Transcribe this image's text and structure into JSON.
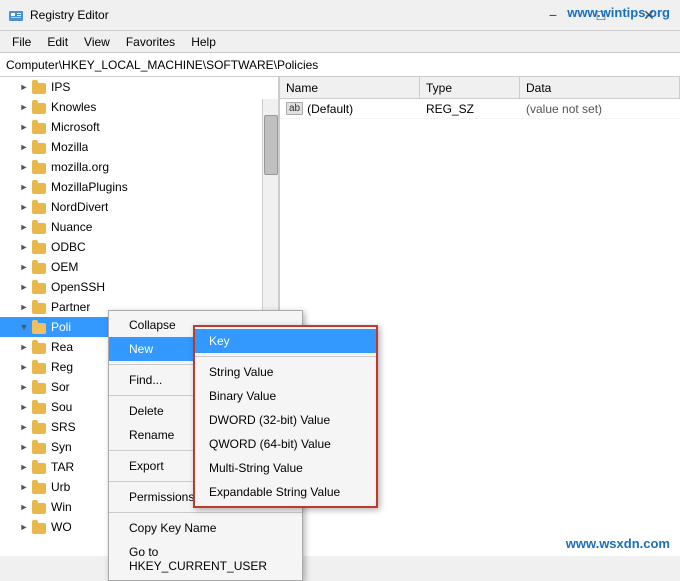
{
  "titleBar": {
    "title": "Registry Editor",
    "icon": "registry-icon"
  },
  "watermarks": {
    "top": "www.wintips.org",
    "bottom": "www.wsxdn.com"
  },
  "menuBar": {
    "items": [
      "File",
      "Edit",
      "View",
      "Favorites",
      "Help"
    ]
  },
  "addressBar": {
    "path": "Computer\\HKEY_LOCAL_MACHINE\\SOFTWARE\\Policies"
  },
  "treePanel": {
    "header": "",
    "items": [
      {
        "label": "IPS",
        "indent": 1,
        "expanded": false
      },
      {
        "label": "Knowles",
        "indent": 1,
        "expanded": false
      },
      {
        "label": "Microsoft",
        "indent": 1,
        "expanded": false
      },
      {
        "label": "Mozilla",
        "indent": 1,
        "expanded": false
      },
      {
        "label": "mozilla.org",
        "indent": 1,
        "expanded": false
      },
      {
        "label": "MozillaPlugins",
        "indent": 1,
        "expanded": false
      },
      {
        "label": "NordDivert",
        "indent": 1,
        "expanded": false
      },
      {
        "label": "Nuance",
        "indent": 1,
        "expanded": false
      },
      {
        "label": "ODBC",
        "indent": 1,
        "expanded": false
      },
      {
        "label": "OEM",
        "indent": 1,
        "expanded": false
      },
      {
        "label": "OpenSSH",
        "indent": 1,
        "expanded": false
      },
      {
        "label": "Partner",
        "indent": 1,
        "expanded": false
      },
      {
        "label": "Poli",
        "indent": 1,
        "expanded": true,
        "selected": true
      },
      {
        "label": "Rea",
        "indent": 1,
        "expanded": false
      },
      {
        "label": "Reg",
        "indent": 1,
        "expanded": false
      },
      {
        "label": "Sor",
        "indent": 1,
        "expanded": false
      },
      {
        "label": "Sou",
        "indent": 1,
        "expanded": false
      },
      {
        "label": "SRS",
        "indent": 1,
        "expanded": false
      },
      {
        "label": "Syn",
        "indent": 1,
        "expanded": false
      },
      {
        "label": "TAR",
        "indent": 1,
        "expanded": false
      },
      {
        "label": "Urb",
        "indent": 1,
        "expanded": false
      },
      {
        "label": "Win",
        "indent": 1,
        "expanded": false
      },
      {
        "label": "WO",
        "indent": 1,
        "expanded": false
      }
    ]
  },
  "rightPanel": {
    "columns": [
      "Name",
      "Type",
      "Data"
    ],
    "rows": [
      {
        "name": "(Default)",
        "type": "REG_SZ",
        "data": "(value not set)",
        "hasAbIcon": true
      }
    ]
  },
  "contextMenu": {
    "items": [
      {
        "label": "Collapse",
        "type": "item"
      },
      {
        "label": "New",
        "type": "item",
        "hasArrow": true,
        "highlighted": true
      },
      {
        "type": "separator"
      },
      {
        "label": "Find...",
        "type": "item"
      },
      {
        "type": "separator"
      },
      {
        "label": "Delete",
        "type": "item"
      },
      {
        "label": "Rename",
        "type": "item"
      },
      {
        "type": "separator"
      },
      {
        "label": "Export",
        "type": "item"
      },
      {
        "type": "separator"
      },
      {
        "label": "Permissions...",
        "type": "item"
      },
      {
        "type": "separator"
      },
      {
        "label": "Copy Key Name",
        "type": "item"
      },
      {
        "label": "Go to HKEY_CURRENT_USER",
        "type": "item"
      }
    ]
  },
  "submenu": {
    "items": [
      {
        "label": "Key",
        "highlighted": true
      },
      {
        "type": "separator"
      },
      {
        "label": "String Value"
      },
      {
        "label": "Binary Value"
      },
      {
        "label": "DWORD (32-bit) Value"
      },
      {
        "label": "QWORD (64-bit) Value"
      },
      {
        "label": "Multi-String Value"
      },
      {
        "label": "Expandable String Value"
      }
    ]
  }
}
